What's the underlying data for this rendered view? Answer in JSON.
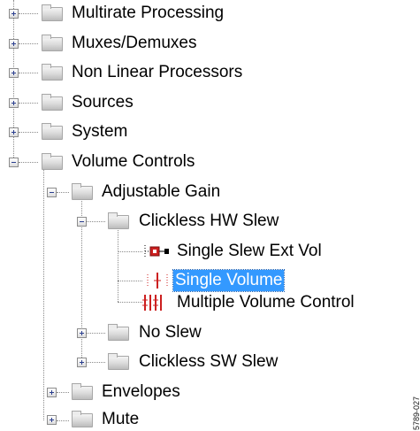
{
  "tree": {
    "rows": [
      {
        "label": "Multirate Processing",
        "state": "collapsed"
      },
      {
        "label": "Muxes/Demuxes",
        "state": "collapsed"
      },
      {
        "label": "Non Linear Processors",
        "state": "collapsed"
      },
      {
        "label": "Sources",
        "state": "collapsed"
      },
      {
        "label": "System",
        "state": "collapsed"
      },
      {
        "label": "Volume Controls",
        "state": "expanded"
      },
      {
        "label": "Adjustable Gain",
        "state": "expanded"
      },
      {
        "label": "Clickless HW Slew",
        "state": "expanded"
      },
      {
        "label": "Single Slew Ext Vol",
        "icon": "slew-ext-vol-block-icon"
      },
      {
        "label": "Single Volume",
        "icon": "single-volume-block-icon",
        "selected": true
      },
      {
        "label": "Multiple Volume Control",
        "icon": "multiple-volume-block-icon"
      },
      {
        "label": "No Slew",
        "state": "collapsed"
      },
      {
        "label": "Clickless SW Slew",
        "state": "collapsed"
      },
      {
        "label": "Envelopes",
        "state": "collapsed"
      },
      {
        "label": "Mute",
        "state": "collapsed"
      }
    ]
  },
  "watermark": "5789-027",
  "colors": {
    "selection": "#3399ff",
    "selection_text": "#ffffff",
    "expander_sign": "#2b3f8f",
    "tree_lines": "#8a8a8a",
    "block_icon_red": "#cc2020"
  }
}
